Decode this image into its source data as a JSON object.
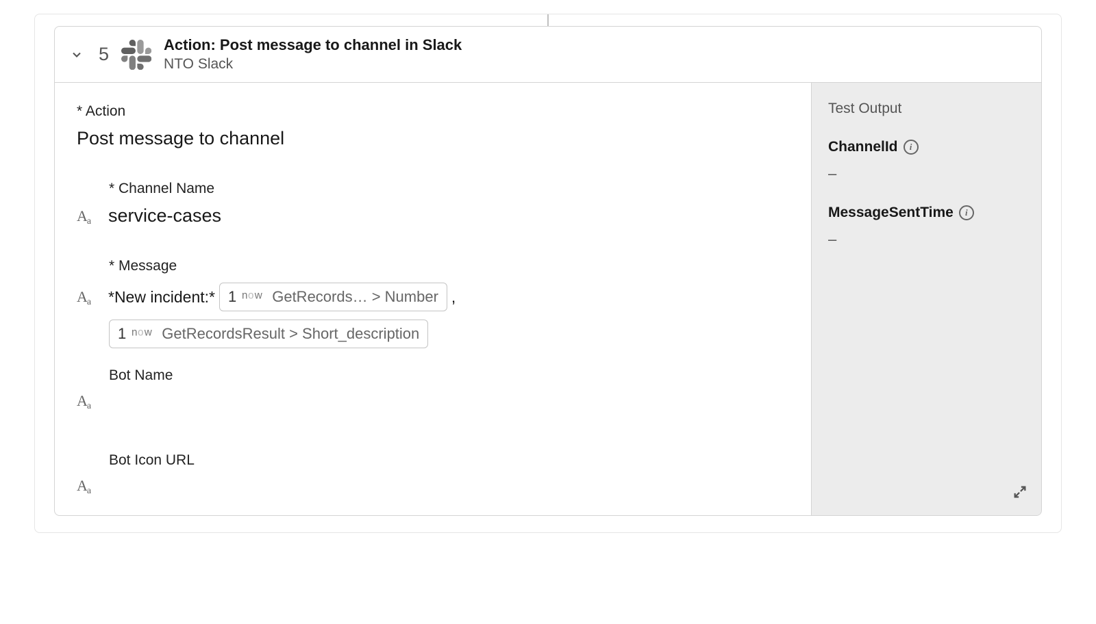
{
  "header": {
    "step_number": "5",
    "title": "Action: Post message to channel in Slack",
    "subtitle": "NTO Slack"
  },
  "fields": {
    "action_label": "* Action",
    "action_value": "Post message to channel",
    "channel_label": "* Channel Name",
    "channel_value": "service-cases",
    "message_label": "* Message",
    "message_prefix": "*New incident:*",
    "pill1_step": "1",
    "pill1_text": "GetRecords…  > Number",
    "message_comma": ",",
    "pill2_step": "1",
    "pill2_text": "GetRecordsResult > Short_description",
    "botname_label": "Bot Name",
    "boticon_label": "Bot Icon URL"
  },
  "sidebar": {
    "title": "Test Output",
    "outputs": [
      {
        "label": "ChannelId",
        "value": "–"
      },
      {
        "label": "MessageSentTime",
        "value": "–"
      }
    ]
  }
}
